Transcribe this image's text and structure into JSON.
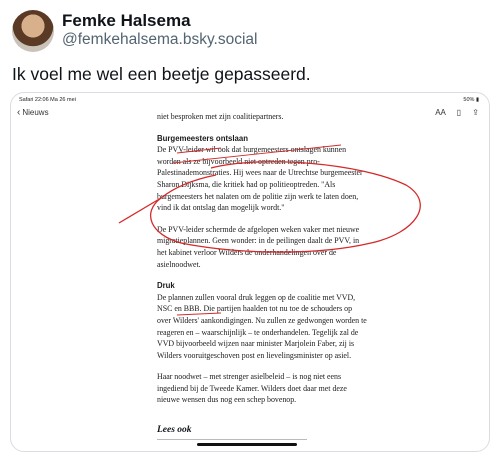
{
  "tweet": {
    "name": "Femke Halsema",
    "handle": "@femkehalsema.bsky.social",
    "text": "Ik voel me wel een beetje gepasseerd."
  },
  "screenshot": {
    "status_left": "Safari  22:06  Ma 26 mei",
    "status_right": "50% ▮",
    "back_label": "Nieuws",
    "nav_icons": [
      "text-size-icon",
      "bookmark-icon",
      "share-icon"
    ],
    "text_size_label": "AA",
    "intro_line": "niet besproken met zijn coalitiepartners.",
    "section1_heading": "Burgemeesters ontslaan",
    "section1_text": "De PVV-leider wil ook dat burgemeesters ontslagen kunnen worden als ze bijvoorbeeld niet optreden tegen pro-Palestinademonstraties. Hij wees naar de Utrechtse burgemeester Sharon Dijksma, die kritiek had op politieoptreden. \"Als burgemeesters het nalaten om de politie zijn werk te laten doen, vind ik dat ontslag dan mogelijk wordt.\"",
    "para2": "De PVV-leider schermde de afgelopen weken vaker met nieuwe migratieplannen. Geen wonder: in de peilingen daalt de PVV, in het kabinet verloor Wilders de onderhandelingen over de asielnoodwet.",
    "section2_heading": "Druk",
    "section2_text": "De plannen zullen vooral druk leggen op de coalitie met VVD, NSC en BBB. Die partijen haalden tot nu toe de schouders op over Wilders' aankondigingen. Nu zullen ze gedwongen worden te reageren en – waarschijnlijk – te onderhandelen. Tegelijk zal de VVD bijvoorbeeld wijzen naar minister Marjolein Faber, zij is Wilders vooruitgeschoven post en lievelingsminister op asiel.",
    "para4": "Haar noodwet – met strenger asielbeleid – is nog niet eens ingediend bij de Tweede Kamer. Wilders doet daar met deze nieuwe wensen dus nog een schep bovenop.",
    "lees_ook": "Lees ook"
  },
  "colors": {
    "annotation": "#d42a2a",
    "handle": "#536471"
  }
}
